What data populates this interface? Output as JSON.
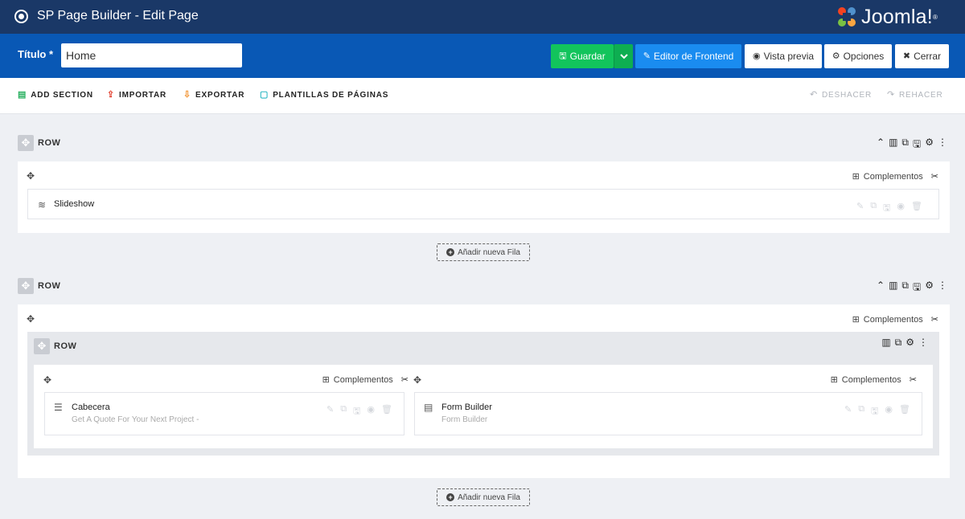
{
  "app": {
    "title": "SP Page Builder - Edit Page",
    "logo_text": "Joomla!",
    "logo_reg": "®"
  },
  "toolbar": {
    "title_label": "Título *",
    "title_value": "Home",
    "save_label": "Guardar",
    "frontend_label": "Editor de Frontend",
    "preview_label": "Vista previa",
    "options_label": "Opciones",
    "close_label": "Cerrar"
  },
  "actions": {
    "add_section": "ADD SECTION",
    "import": "IMPORTAR",
    "export": "EXPORTAR",
    "templates": "PLANTILLAS DE PÁGINAS",
    "undo": "DESHACER",
    "redo": "REHACER"
  },
  "rows": [
    {
      "label": "ROW",
      "addons_label": "Complementos",
      "addon": {
        "title": "Slideshow",
        "icon": "slideshow-icon"
      },
      "add_row_label": "Añadir nueva Fila"
    },
    {
      "label": "ROW",
      "addons_label": "Complementos",
      "inner_row": {
        "label": "ROW",
        "columns": [
          {
            "addons_label": "Complementos",
            "addon": {
              "title": "Cabecera",
              "subtitle": "Get A Quote For Your Next Project -",
              "icon": "heading-icon"
            }
          },
          {
            "addons_label": "Complementos",
            "addon": {
              "title": "Form Builder",
              "subtitle": "Form Builder",
              "icon": "form-icon"
            }
          }
        ]
      },
      "add_row_label": "Añadir nueva Fila"
    }
  ],
  "colors": {
    "topbar": "#1a3867",
    "toolbar": "#0958b5",
    "save": "#12c45c",
    "frontend": "#1a8cf0"
  }
}
